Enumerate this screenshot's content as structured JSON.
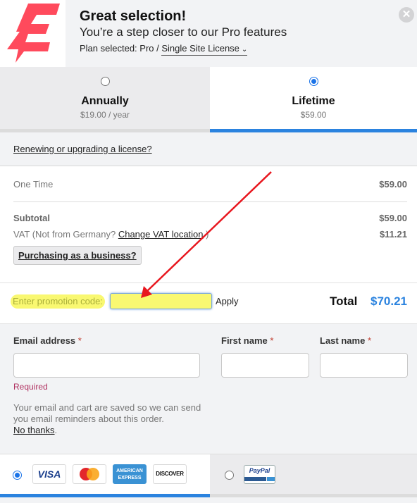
{
  "header": {
    "title": "Great selection!",
    "subtitle": "You’re a step closer to our Pro features",
    "plan_prefix": "Plan selected: Pro / ",
    "plan_license": "Single Site License",
    "chevron": "⌄",
    "close_icon": "✕",
    "brand_color": "#ff4a5c"
  },
  "tabs": [
    {
      "label": "Annually",
      "price": "$19.00 / year",
      "selected": false
    },
    {
      "label": "Lifetime",
      "price": "$59.00",
      "selected": true
    }
  ],
  "renew_link": "Renewing or upgrading a license?",
  "summary": {
    "one_time_label": "One Time",
    "one_time_value": "$59.00",
    "subtotal_label": "Subtotal",
    "subtotal_value": "$59.00",
    "vat_prefix": "VAT (Not from Germany? ",
    "vat_link": "Change VAT location",
    "vat_suffix": " )",
    "vat_value": "$11.21",
    "business_button": "Purchasing as a business?"
  },
  "promo": {
    "label": "Enter promotion code:",
    "value": "",
    "apply": "Apply"
  },
  "total": {
    "label": "Total",
    "value": "$70.21",
    "color": "#2b83df"
  },
  "form": {
    "email_label": "Email address",
    "first_name_label": "First name",
    "last_name_label": "Last name",
    "required_star": "*",
    "email_value": "",
    "first_name_value": "",
    "last_name_value": "",
    "required_msg": "Required",
    "note": "Your email and cart are saved so we can send you email reminders about this order.",
    "no_thanks": "No thanks",
    "no_thanks_suffix": "."
  },
  "payment": {
    "card_selected": true,
    "cards": [
      "VISA",
      "MasterCard",
      "AMERICAN EXPRESS",
      "DISCOVER"
    ],
    "paypal_label": "PayPal"
  }
}
